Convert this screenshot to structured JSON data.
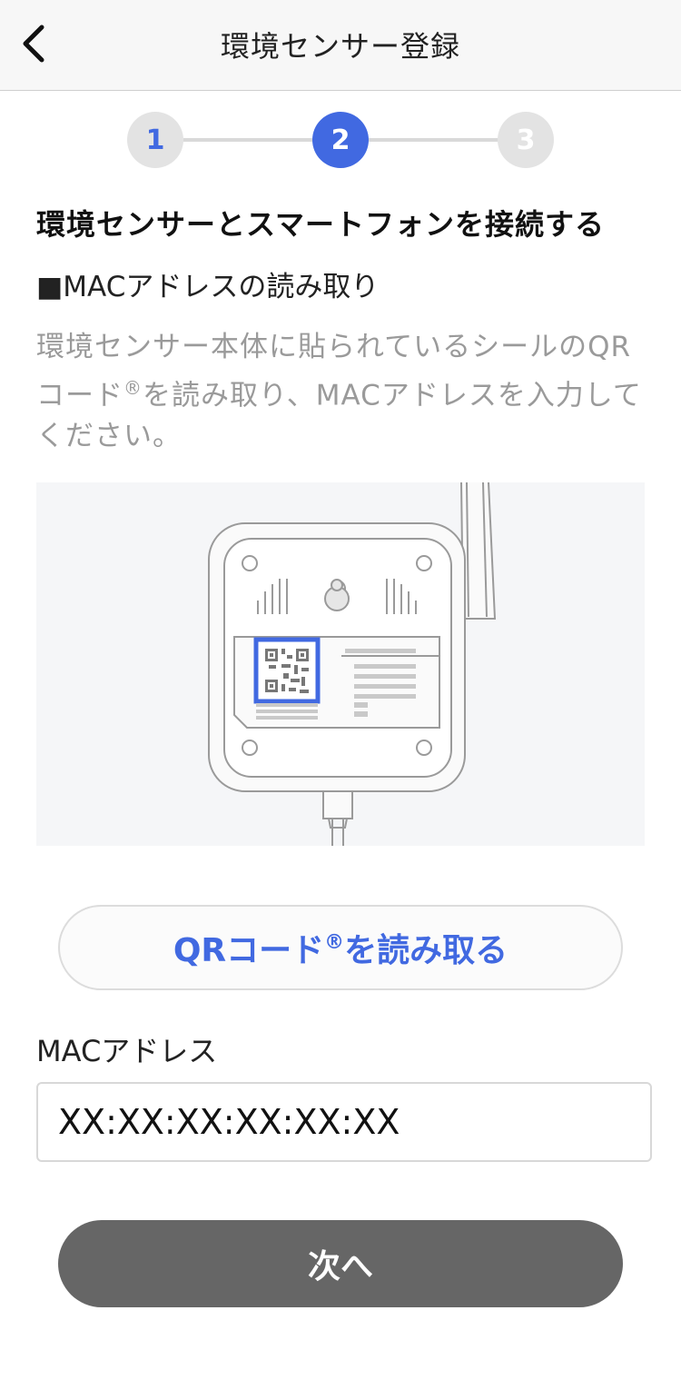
{
  "header": {
    "title": "環境センサー登録",
    "back_icon": "chevron-left-icon"
  },
  "stepper": {
    "steps": [
      {
        "label": "1",
        "state": "done"
      },
      {
        "label": "2",
        "state": "active"
      },
      {
        "label": "3",
        "state": "upcoming"
      }
    ],
    "active_color": "#4169e1"
  },
  "content": {
    "section_title": "環境センサーとスマートフォンを接続する",
    "sub_title": "■MACアドレスの読み取り",
    "description_part1": "環境センサー本体に貼られているシールのQRコード",
    "description_mark": "®",
    "description_part2": "を読み取り、MACアドレスを入力してください。"
  },
  "illustration": {
    "name": "sensor-device-qr-illustration"
  },
  "qr_button": {
    "label_part1": "QRコード",
    "label_mark": "®",
    "label_part2": "を読み取る"
  },
  "mac_field": {
    "label": "MACアドレス",
    "value": "XX:XX:XX:XX:XX:XX"
  },
  "next_button": {
    "label": "次へ"
  }
}
